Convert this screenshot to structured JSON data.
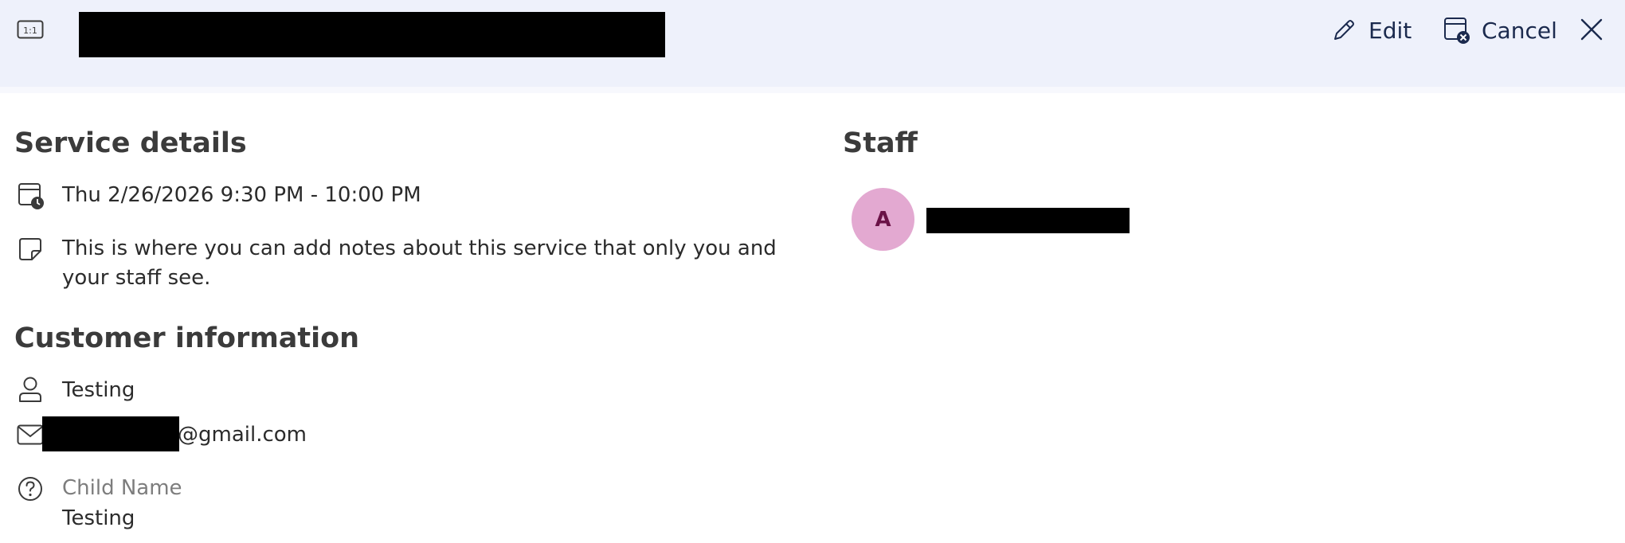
{
  "header": {
    "ratio_badge": "1:1",
    "title": "",
    "edit_label": "Edit",
    "cancel_label": "Cancel",
    "background": "#eef1fb",
    "accent": "#1b2a4e"
  },
  "service_details": {
    "title": "Service details",
    "datetime": "Thu 2/26/2026 9:30 PM - 10:00 PM",
    "notes": "This is where you can add notes about this service that only you and your staff see."
  },
  "customer_information": {
    "title": "Customer information",
    "name": "Testing",
    "email_suffix": "@gmail.com",
    "custom_field_label": "Child Name",
    "custom_field_value": "Testing"
  },
  "staff": {
    "title": "Staff",
    "avatar_initial": "A",
    "avatar_color": "#e3a9d1"
  },
  "icons": [
    "aspect-ratio-icon",
    "pencil-icon",
    "calendar-cancel-icon",
    "close-icon",
    "calendar-clock-icon",
    "note-icon",
    "person-icon",
    "mail-icon",
    "question-icon"
  ]
}
